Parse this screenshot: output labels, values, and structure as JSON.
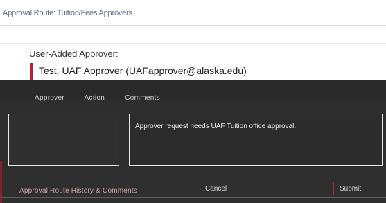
{
  "page": {
    "title": "Approval Route: Tuition/Fees Approvers"
  },
  "approvers": {
    "section_label": "User-Added Approver:",
    "items": [
      {
        "name": "Test, UAF Approver (UAFapprover@alaska.edu)"
      }
    ]
  },
  "comments_table": {
    "headers": [
      "Approver",
      "Action",
      "Comments"
    ],
    "note": "",
    "comment": "Approver request needs UAF Tuition office approval."
  },
  "footer": {
    "link_label": "Approval Route History & Comments",
    "cancel_label": "Cancel",
    "submit_label": "Submit"
  },
  "colors": {
    "accent": "#b8232f",
    "panel_dark": "#2e2e2e"
  }
}
